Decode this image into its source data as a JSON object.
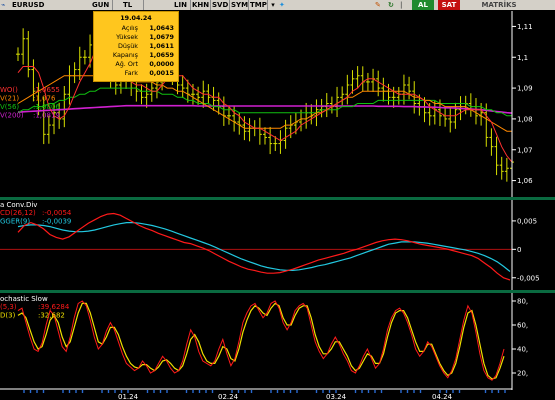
{
  "toolbar": {
    "symbol": "EURUSD",
    "tabs": [
      "GUN",
      "TL",
      "LIN",
      "KHN",
      "SVD",
      "SYM",
      "TMP"
    ],
    "buttons": [
      "AL",
      "SAT",
      "MATRİKS"
    ]
  },
  "tooltip": {
    "date": "19.04.24",
    "rows": [
      {
        "label": "Açılış",
        "value": "1,0643"
      },
      {
        "label": "Yüksek",
        "value": "1,0679"
      },
      {
        "label": "Düşük",
        "value": "1,0611"
      },
      {
        "label": "Kapanış",
        "value": "1,0659"
      },
      {
        "label": "Ağ. Ort",
        "value": "0,0000"
      },
      {
        "label": "Fark",
        "value": "0,0015"
      }
    ]
  },
  "colors": {
    "bg": "#000000",
    "price": "#d8e000",
    "ma5": "#ff3030",
    "ma21": "#ff8800",
    "ma56": "#10c010",
    "ma200": "#d020d0",
    "macd": "#ff1a1a",
    "signal": "#22c8e0",
    "stochK": "#ff1a1a",
    "stochD": "#f0e000",
    "axis": "#ffffff",
    "separator": "#0a6a40"
  },
  "chart_data": [
    {
      "type": "ohlc",
      "panel": "price",
      "yticks": [
        "1,11",
        "1,1",
        "1,09",
        "1,08",
        "1,07",
        "1,06"
      ],
      "ylim": [
        1.055,
        1.115
      ],
      "xticks": [
        "01.24",
        "02.24",
        "03.24",
        "04.24"
      ],
      "legend": [
        "WO()",
        "V(21)",
        "V(56)",
        "V(200)"
      ],
      "legend_values": [
        ":1,0655",
        ":1,076",
        ":1,0806",
        ":1,0819"
      ],
      "close": [
        1.101,
        1.106,
        1.096,
        1.089,
        1.084,
        1.075,
        1.078,
        1.082,
        1.08,
        1.088,
        1.094,
        1.096,
        1.1,
        1.1,
        1.104,
        1.108,
        1.106,
        1.097,
        1.093,
        1.091,
        1.094,
        1.093,
        1.09,
        1.089,
        1.087,
        1.088,
        1.09,
        1.092,
        1.096,
        1.097,
        1.094,
        1.091,
        1.09,
        1.088,
        1.088,
        1.087,
        1.089,
        1.087,
        1.086,
        1.084,
        1.081,
        1.081,
        1.079,
        1.078,
        1.076,
        1.077,
        1.077,
        1.075,
        1.074,
        1.072,
        1.072,
        1.073,
        1.077,
        1.078,
        1.079,
        1.08,
        1.082,
        1.081,
        1.083,
        1.084,
        1.085,
        1.084,
        1.087,
        1.088,
        1.091,
        1.093,
        1.094,
        1.092,
        1.092,
        1.093,
        1.09,
        1.089,
        1.087,
        1.087,
        1.088,
        1.091,
        1.089,
        1.085,
        1.084,
        1.082,
        1.081,
        1.083,
        1.081,
        1.08,
        1.079,
        1.083,
        1.084,
        1.085,
        1.084,
        1.081,
        1.082,
        1.074,
        1.071,
        1.065,
        1.063,
        1.064,
        1.066
      ],
      "ma5": [
        1.095,
        1.097,
        1.097,
        1.097,
        1.095,
        1.09,
        1.084,
        1.081,
        1.08,
        1.081,
        1.084,
        1.088,
        1.092,
        1.095,
        1.098,
        1.102,
        1.104,
        1.103,
        1.102,
        1.099,
        1.096,
        1.094,
        1.092,
        1.091,
        1.091,
        1.09,
        1.089,
        1.089,
        1.091,
        1.093,
        1.094,
        1.094,
        1.094,
        1.092,
        1.09,
        1.089,
        1.088,
        1.088,
        1.087,
        1.087,
        1.085,
        1.084,
        1.082,
        1.081,
        1.079,
        1.078,
        1.077,
        1.077,
        1.076,
        1.075,
        1.074,
        1.073,
        1.074,
        1.075,
        1.076,
        1.078,
        1.079,
        1.08,
        1.081,
        1.082,
        1.083,
        1.084,
        1.085,
        1.086,
        1.087,
        1.089,
        1.09,
        1.092,
        1.093,
        1.093,
        1.092,
        1.091,
        1.09,
        1.089,
        1.088,
        1.088,
        1.088,
        1.088,
        1.087,
        1.086,
        1.084,
        1.083,
        1.082,
        1.081,
        1.081,
        1.081,
        1.082,
        1.083,
        1.083,
        1.083,
        1.083,
        1.081,
        1.079,
        1.075,
        1.071,
        1.068,
        1.066
      ],
      "ma21": [
        1.085,
        1.086,
        1.087,
        1.088,
        1.089,
        1.09,
        1.091,
        1.092,
        1.093,
        1.094,
        1.094,
        1.094,
        1.094,
        1.094,
        1.094,
        1.094,
        1.094,
        1.094,
        1.093,
        1.093,
        1.093,
        1.093,
        1.093,
        1.092,
        1.092,
        1.092,
        1.092,
        1.091,
        1.091,
        1.09,
        1.09,
        1.089,
        1.089,
        1.088,
        1.087,
        1.086,
        1.085,
        1.084,
        1.083,
        1.082,
        1.081,
        1.08,
        1.079,
        1.078,
        1.077,
        1.077,
        1.077,
        1.077,
        1.077,
        1.077,
        1.077,
        1.077,
        1.078,
        1.078,
        1.079,
        1.08,
        1.08,
        1.081,
        1.082,
        1.082,
        1.083,
        1.084,
        1.085,
        1.086,
        1.087,
        1.087,
        1.088,
        1.089,
        1.089,
        1.089,
        1.089,
        1.089,
        1.089,
        1.089,
        1.089,
        1.089,
        1.088,
        1.087,
        1.087,
        1.086,
        1.086,
        1.085,
        1.085,
        1.084,
        1.084,
        1.084,
        1.084,
        1.084,
        1.083,
        1.082,
        1.081,
        1.08,
        1.079,
        1.078,
        1.077,
        1.076,
        1.076
      ],
      "ma56": [
        1.082,
        1.083,
        1.083,
        1.084,
        1.084,
        1.084,
        1.085,
        1.085,
        1.086,
        1.086,
        1.087,
        1.087,
        1.088,
        1.088,
        1.089,
        1.089,
        1.09,
        1.09,
        1.09,
        1.09,
        1.09,
        1.09,
        1.09,
        1.09,
        1.089,
        1.089,
        1.089,
        1.089,
        1.088,
        1.088,
        1.088,
        1.087,
        1.087,
        1.086,
        1.086,
        1.085,
        1.085,
        1.085,
        1.084,
        1.084,
        1.083,
        1.083,
        1.083,
        1.082,
        1.082,
        1.082,
        1.082,
        1.082,
        1.082,
        1.082,
        1.082,
        1.082,
        1.082,
        1.082,
        1.082,
        1.082,
        1.082,
        1.082,
        1.082,
        1.083,
        1.083,
        1.083,
        1.083,
        1.084,
        1.084,
        1.084,
        1.085,
        1.085,
        1.085,
        1.085,
        1.086,
        1.086,
        1.086,
        1.086,
        1.086,
        1.086,
        1.086,
        1.086,
        1.086,
        1.086,
        1.086,
        1.086,
        1.085,
        1.085,
        1.085,
        1.085,
        1.085,
        1.085,
        1.084,
        1.084,
        1.084,
        1.083,
        1.083,
        1.082,
        1.082,
        1.081,
        1.081
      ],
      "ma200": [
        1.0822,
        1.0823,
        1.0824,
        1.0825,
        1.0826,
        1.0827,
        1.0828,
        1.0829,
        1.083,
        1.0831,
        1.0832,
        1.0833,
        1.0834,
        1.0835,
        1.0836,
        1.0837,
        1.0838,
        1.0839,
        1.084,
        1.0841,
        1.0842,
        1.0843,
        1.0843,
        1.0843,
        1.0843,
        1.0843,
        1.0843,
        1.0843,
        1.0843,
        1.0843,
        1.0843,
        1.0843,
        1.0843,
        1.0843,
        1.0843,
        1.0842,
        1.0842,
        1.0842,
        1.0842,
        1.0842,
        1.0842,
        1.0842,
        1.0842,
        1.0842,
        1.0842,
        1.0842,
        1.0842,
        1.0842,
        1.0842,
        1.0842,
        1.0842,
        1.0842,
        1.0842,
        1.0842,
        1.0842,
        1.0842,
        1.0842,
        1.0842,
        1.0842,
        1.0842,
        1.0842,
        1.0842,
        1.0842,
        1.0842,
        1.0842,
        1.0842,
        1.0842,
        1.0842,
        1.0842,
        1.0842,
        1.0841,
        1.0841,
        1.0841,
        1.0841,
        1.0841,
        1.084,
        1.084,
        1.084,
        1.0839,
        1.0839,
        1.0838,
        1.0838,
        1.0837,
        1.0836,
        1.0836,
        1.0835,
        1.0834,
        1.0833,
        1.0832,
        1.0831,
        1.083,
        1.0828,
        1.0826,
        1.0824,
        1.0822,
        1.082,
        1.0819
      ]
    },
    {
      "type": "line",
      "panel": "macd",
      "title": "a Conv.Div",
      "legend": [
        "CD(26,12)",
        "GGER(9)"
      ],
      "legend_values": [
        ":-0,0054",
        ":-0,0039"
      ],
      "yticks": [
        "0,005",
        "0",
        "-0,005"
      ],
      "ylim": [
        -0.0068,
        0.0085
      ],
      "macd": [
        0.003,
        0.0042,
        0.0047,
        0.0043,
        0.0036,
        0.0026,
        0.0021,
        0.0018,
        0.0022,
        0.003,
        0.0038,
        0.0046,
        0.0052,
        0.0058,
        0.0062,
        0.0063,
        0.006,
        0.0054,
        0.0048,
        0.0042,
        0.0037,
        0.0033,
        0.0028,
        0.0024,
        0.002,
        0.0016,
        0.0012,
        0.001,
        0.0006,
        0.0002,
        -0.0003,
        -0.0009,
        -0.0015,
        -0.0021,
        -0.0026,
        -0.0031,
        -0.0035,
        -0.0037,
        -0.004,
        -0.0042,
        -0.0042,
        -0.0041,
        -0.0038,
        -0.0035,
        -0.0031,
        -0.0027,
        -0.0023,
        -0.0019,
        -0.0016,
        -0.0013,
        -0.001,
        -0.0007,
        -0.0003,
        0.0,
        0.0004,
        0.0008,
        0.0012,
        0.0015,
        0.0017,
        0.0018,
        0.0017,
        0.0015,
        0.0012,
        0.0009,
        0.0007,
        0.0005,
        0.0003,
        0.0001,
        -0.0002,
        -0.0005,
        -0.0008,
        -0.0011,
        -0.0016,
        -0.0024,
        -0.0032,
        -0.0042,
        -0.005,
        -0.0054
      ],
      "signal": [
        0.004,
        0.0042,
        0.0043,
        0.0043,
        0.0042,
        0.004,
        0.0037,
        0.0034,
        0.0032,
        0.0031,
        0.0031,
        0.0032,
        0.0034,
        0.0037,
        0.004,
        0.0043,
        0.0045,
        0.0047,
        0.0047,
        0.0046,
        0.0044,
        0.0042,
        0.0039,
        0.0036,
        0.0032,
        0.0028,
        0.0024,
        0.002,
        0.0016,
        0.0012,
        0.0008,
        0.0003,
        -0.0002,
        -0.0007,
        -0.0012,
        -0.0017,
        -0.0021,
        -0.0025,
        -0.0029,
        -0.0032,
        -0.0034,
        -0.0036,
        -0.0037,
        -0.0037,
        -0.0036,
        -0.0034,
        -0.0032,
        -0.0029,
        -0.0027,
        -0.0024,
        -0.0021,
        -0.0018,
        -0.0015,
        -0.0011,
        -0.0007,
        -0.0003,
        0.0001,
        0.0005,
        0.0009,
        0.0011,
        0.0013,
        0.0013,
        0.0013,
        0.0012,
        0.0011,
        0.0009,
        0.0007,
        0.0005,
        0.0003,
        0.0001,
        -0.0001,
        -0.0004,
        -0.0007,
        -0.0011,
        -0.0016,
        -0.0022,
        -0.003,
        -0.0039
      ]
    },
    {
      "type": "line",
      "panel": "stochastic",
      "title": "ochastic Slow",
      "legend": [
        "(5,3)",
        "D(3)"
      ],
      "legend_values": [
        ":39,6284",
        ":32,682"
      ],
      "yticks": [
        "80",
        "60",
        "40",
        "20"
      ],
      "ylim": [
        10,
        85
      ],
      "k": [
        72,
        74,
        62,
        50,
        40,
        38,
        45,
        60,
        72,
        68,
        55,
        42,
        38,
        50,
        66,
        78,
        80,
        76,
        64,
        50,
        40,
        44,
        55,
        62,
        56,
        46,
        36,
        28,
        25,
        22,
        24,
        30,
        26,
        20,
        22,
        28,
        34,
        30,
        24,
        20,
        22,
        30,
        44,
        56,
        50,
        38,
        30,
        28,
        26,
        30,
        40,
        48,
        36,
        26,
        32,
        46,
        62,
        70,
        76,
        78,
        72,
        66,
        70,
        78,
        80,
        74,
        62,
        56,
        62,
        72,
        76,
        78,
        74,
        60,
        46,
        38,
        32,
        36,
        44,
        50,
        44,
        36,
        30,
        22,
        20,
        26,
        34,
        40,
        32,
        24,
        28,
        40,
        56,
        66,
        72,
        74,
        70,
        62,
        52,
        40,
        34,
        38,
        46,
        42,
        34,
        26,
        20,
        16,
        22,
        32,
        48,
        64,
        76,
        70,
        54,
        36,
        22,
        16,
        14,
        18,
        28,
        40
      ],
      "d": [
        68,
        70,
        66,
        56,
        46,
        40,
        42,
        52,
        64,
        68,
        62,
        50,
        42,
        46,
        58,
        70,
        78,
        78,
        70,
        58,
        46,
        44,
        50,
        58,
        58,
        52,
        42,
        34,
        28,
        25,
        24,
        27,
        27,
        24,
        22,
        25,
        30,
        31,
        28,
        24,
        22,
        26,
        36,
        48,
        52,
        46,
        36,
        30,
        28,
        28,
        34,
        42,
        40,
        32,
        30,
        40,
        54,
        64,
        72,
        76,
        74,
        70,
        68,
        74,
        78,
        76,
        66,
        60,
        60,
        68,
        74,
        76,
        76,
        66,
        52,
        42,
        36,
        36,
        40,
        46,
        46,
        40,
        34,
        26,
        22,
        24,
        30,
        36,
        34,
        28,
        28,
        36,
        50,
        62,
        70,
        72,
        72,
        66,
        56,
        46,
        38,
        38,
        44,
        44,
        36,
        28,
        22,
        18,
        20,
        28,
        42,
        58,
        70,
        72,
        60,
        44,
        28,
        18,
        15,
        16,
        24,
        34
      ]
    }
  ]
}
